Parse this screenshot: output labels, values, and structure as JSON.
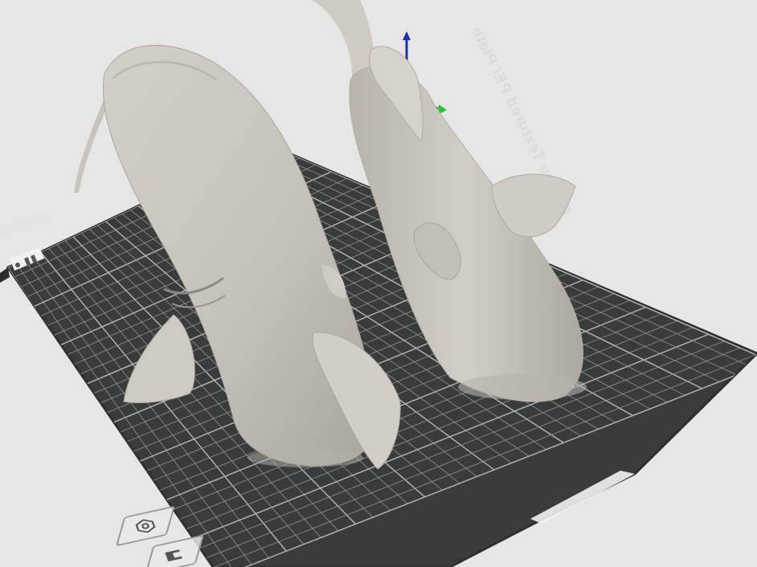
{
  "app": {
    "view": "3D prepare view",
    "plate": {
      "label": "Bambu Textured PEI Plate",
      "colors": {
        "plate": "#3a3c3c",
        "grid": "#8f9494",
        "grid_major": "#b3b8b8",
        "edge": "#2e2f2f"
      }
    },
    "models": [
      {
        "name": "fish-model-left",
        "color": "#c9c5bd"
      },
      {
        "name": "fish-model-right",
        "color": "#c9c5bd"
      }
    ],
    "gizmo": {
      "z_color": "#1e2fb5",
      "y_color": "#2fbf3a"
    },
    "plate_tools": [
      {
        "name": "auto-orient-icon"
      },
      {
        "name": "arrange-icon"
      }
    ],
    "background": "#e6e6e6"
  }
}
